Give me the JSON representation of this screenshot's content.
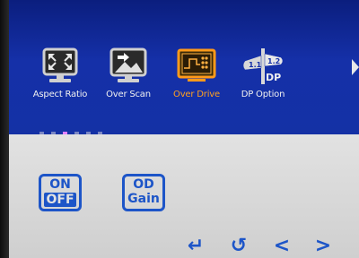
{
  "menu": {
    "items": [
      {
        "icon": "aspect-ratio-icon",
        "label": "Aspect Ratio",
        "selected": false
      },
      {
        "icon": "over-scan-icon",
        "label": "Over Scan",
        "selected": false
      },
      {
        "icon": "over-drive-icon",
        "label": "Over Drive",
        "selected": true
      },
      {
        "icon": "dp-option-icon",
        "label": "DP Option",
        "selected": false
      }
    ],
    "dp_badge_left": "1.1",
    "dp_badge_right": "1.2",
    "dp_text": "DP",
    "page_count": 6,
    "active_page": 3
  },
  "options": {
    "onoff": {
      "line1": "ON",
      "line2": "OFF"
    },
    "odgain": {
      "line1": "OD",
      "line2": "Gain"
    }
  },
  "nav": {
    "enter_glyph": "↵",
    "back_glyph": "↺",
    "left_glyph": "<",
    "right_glyph": ">"
  },
  "colors": {
    "menu_bg": "#1530a8",
    "selected_label": "#ffa020",
    "icon_blue": "#1d55c8",
    "content_bg": "#d8d8d8"
  }
}
